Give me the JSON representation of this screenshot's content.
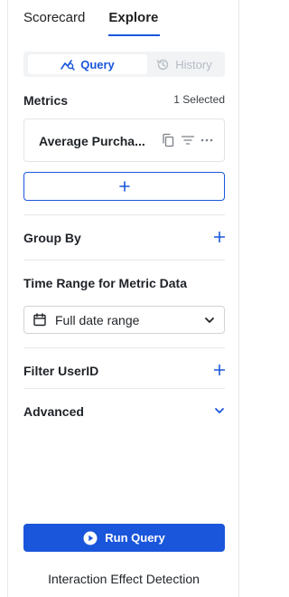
{
  "top_tabs": [
    {
      "label": "Scorecard"
    },
    {
      "label": "Explore"
    }
  ],
  "mode_switch": {
    "query": {
      "label": "Query",
      "icon": "query-chart-icon"
    },
    "history": {
      "label": "History",
      "icon": "history-icon"
    }
  },
  "metrics": {
    "title": "Metrics",
    "selected_count": "1 Selected",
    "items": [
      {
        "name": "Average Purcha..."
      }
    ]
  },
  "group_by": {
    "title": "Group By"
  },
  "time_range": {
    "title": "Time Range for Metric Data",
    "value": "Full date range"
  },
  "filter": {
    "title": "Filter UserID"
  },
  "advanced": {
    "title": "Advanced"
  },
  "run_query": {
    "label": "Run Query"
  },
  "footer": {
    "label": "Interaction Effect Detection"
  },
  "colors": {
    "accent": "#1a56db",
    "divider": "#e6e8eb"
  }
}
